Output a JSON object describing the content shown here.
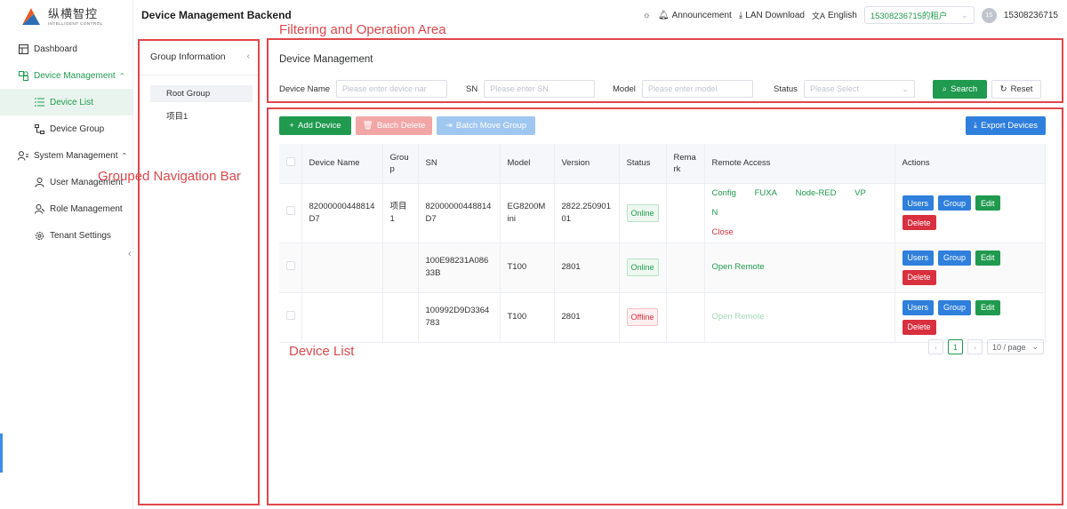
{
  "logo": {
    "main": "纵横智控",
    "sub": "INTELLIGENT CONTROL"
  },
  "header": {
    "title": "Device Management Backend",
    "announcement": "Announcement",
    "lan_download": "LAN Download",
    "language": "English",
    "tenant": "15308236715的租户",
    "avatar_initials": "15",
    "username": "15308236715"
  },
  "sidebar": {
    "items": [
      {
        "label": "Dashboard",
        "icon": "dashboard-icon"
      },
      {
        "label": "Device Management",
        "icon": "device-icon"
      },
      {
        "label": "Device List",
        "icon": "list-icon"
      },
      {
        "label": "Device Group",
        "icon": "group-icon"
      },
      {
        "label": "System Management",
        "icon": "users-icon"
      },
      {
        "label": "User Management",
        "icon": "user-icon"
      },
      {
        "label": "Role Management",
        "icon": "role-icon"
      },
      {
        "label": "Tenant Settings",
        "icon": "gear-icon"
      }
    ]
  },
  "group_panel": {
    "title": "Group Information",
    "items": [
      "Root Group",
      "项目1"
    ]
  },
  "filter": {
    "title": "Device Management",
    "device_name_label": "Device Name",
    "device_name_placeholder": "Please enter device nar",
    "sn_label": "SN",
    "sn_placeholder": "Please enter SN",
    "model_label": "Model",
    "model_placeholder": "Please enter model",
    "status_label": "Status",
    "status_placeholder": "Please Select",
    "search_label": "Search",
    "reset_label": "Reset"
  },
  "toolbar": {
    "add_label": "Add Device",
    "batch_delete_label": "Batch Delete",
    "batch_move_label": "Batch Move Group",
    "export_label": "Export Devices"
  },
  "table": {
    "headers": [
      "Device Name",
      "Group",
      "SN",
      "Model",
      "Version",
      "Status",
      "Remark",
      "Remote Access",
      "Actions"
    ],
    "rows": [
      {
        "name": "82000000448814D7",
        "group": "项目1",
        "sn": "82000000448814D7",
        "model": "EG8200Mini",
        "version": "2822.25090101",
        "status": "Online",
        "remark": ""
      },
      {
        "name": "",
        "group": "",
        "sn": "100E98231A08633B",
        "model": "T100",
        "version": "2801",
        "status": "Online",
        "remark": ""
      },
      {
        "name": "",
        "group": "",
        "sn": "100992D9D3364783",
        "model": "T100",
        "version": "2801",
        "status": "Offline",
        "remark": ""
      }
    ],
    "remote": {
      "config": "Config",
      "fuxa": "FUXA",
      "nodered": "Node-RED",
      "vpn": "VPN",
      "close": "Close",
      "open_remote": "Open Remote"
    },
    "actions": {
      "users": "Users",
      "group": "Group",
      "edit": "Edit",
      "delete": "Delete"
    }
  },
  "pagination": {
    "current": "1",
    "page_size": "10 / page"
  },
  "annotations": {
    "filter": "Filtering and Operation Area",
    "nav": "Grouped Navigation Bar",
    "list": "Device List"
  },
  "colors": {
    "brand_green": "#1f9a4f",
    "danger_red": "#d9303f",
    "primary_blue": "#2f7fdc",
    "annotation_red": "#e0474c"
  }
}
